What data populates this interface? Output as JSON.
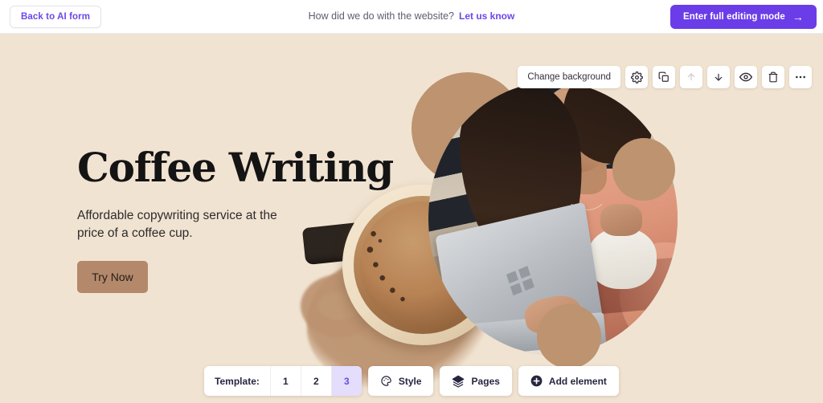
{
  "topbar": {
    "back_button": "Back to AI form",
    "feedback_text": "How did we do with the website?",
    "feedback_link": "Let us know",
    "enter_mode_button": "Enter full editing mode",
    "enter_mode_arrow": "→"
  },
  "section_toolbar": {
    "change_background": "Change background",
    "icons": [
      {
        "name": "settings-gear-icon",
        "title": "Settings"
      },
      {
        "name": "duplicate-icon",
        "title": "Duplicate"
      },
      {
        "name": "move-up-icon",
        "title": "Move up"
      },
      {
        "name": "move-down-icon",
        "title": "Move down"
      },
      {
        "name": "visibility-eye-icon",
        "title": "Hide section"
      },
      {
        "name": "trash-delete-icon",
        "title": "Delete"
      },
      {
        "name": "more-options-icon",
        "title": "More"
      }
    ]
  },
  "hero": {
    "title": "Coffee Writing",
    "subtitle": "Affordable copywriting service at the price of a coffee cup.",
    "cta_label": "Try Now",
    "cta_color": "#b4886a",
    "background_color": "#f1e3d1",
    "circle_color": "#bd9370"
  },
  "bottombar": {
    "template_label": "Template:",
    "templates": [
      {
        "label": "1",
        "selected": false
      },
      {
        "label": "2",
        "selected": false
      },
      {
        "label": "3",
        "selected": true
      }
    ],
    "style_label": "Style",
    "pages_label": "Pages",
    "add_element_label": "Add element",
    "selected_color": "#6c47e8"
  }
}
